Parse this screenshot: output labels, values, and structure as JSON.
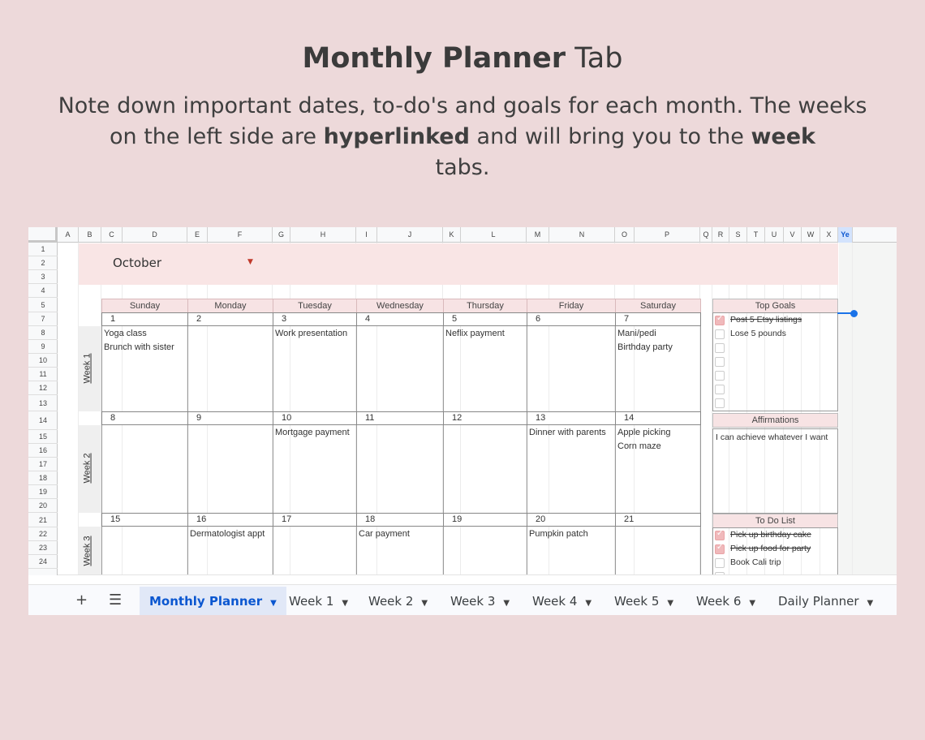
{
  "heading": {
    "title_bold": "Monthly Planner",
    "title_rest": "Tab"
  },
  "description": {
    "part1": "Note down important dates, to-do's and goals for each month. The weeks on the left side are",
    "bold1": "hyperlinked",
    "part2": "and will bring you to the",
    "bold2": "week",
    "part3": "tabs."
  },
  "columns": [
    "A",
    "B",
    "C",
    "D",
    "E",
    "F",
    "G",
    "H",
    "I",
    "J",
    "K",
    "L",
    "M",
    "N",
    "O",
    "P",
    "Q",
    "R",
    "S",
    "T",
    "U",
    "V",
    "W",
    "X",
    "Ye"
  ],
  "rows": [
    "1",
    "2",
    "3",
    "4",
    "5",
    "7",
    "8",
    "9",
    "10",
    "11",
    "12",
    "13",
    "14",
    "15",
    "16",
    "17",
    "18",
    "19",
    "20",
    "21",
    "22",
    "23",
    "24"
  ],
  "calendar": {
    "month": "October",
    "days": [
      "Sunday",
      "Monday",
      "Tuesday",
      "Wednesday",
      "Thursday",
      "Friday",
      "Saturday"
    ],
    "weeks": [
      {
        "label": "Week 1",
        "dates": [
          "1",
          "2",
          "3",
          "4",
          "5",
          "6",
          "7"
        ],
        "events": [
          [
            "Yoga class",
            "Brunch with sister"
          ],
          [],
          [
            "Work presentation"
          ],
          [],
          [
            "Neflix payment"
          ],
          [],
          [
            "Mani/pedi",
            "Birthday party"
          ]
        ]
      },
      {
        "label": "Week 2",
        "dates": [
          "8",
          "9",
          "10",
          "11",
          "12",
          "13",
          "14"
        ],
        "events": [
          [],
          [],
          [
            "Mortgage payment"
          ],
          [],
          [],
          [
            "Dinner with parents"
          ],
          [
            "Apple picking",
            "Corn maze"
          ]
        ]
      },
      {
        "label": "Week 3",
        "dates": [
          "15",
          "16",
          "17",
          "18",
          "19",
          "20",
          "21"
        ],
        "events": [
          [],
          [
            "Dermatologist appt"
          ],
          [],
          [
            "Car payment"
          ],
          [],
          [
            "Pumpkin patch"
          ],
          []
        ]
      }
    ]
  },
  "top_goals": {
    "title": "Top Goals",
    "items": [
      {
        "text": "Post 5 Etsy listings",
        "done": true
      },
      {
        "text": "Lose 5 pounds",
        "done": false
      },
      {
        "text": "",
        "done": false
      },
      {
        "text": "",
        "done": false
      },
      {
        "text": "",
        "done": false
      },
      {
        "text": "",
        "done": false
      },
      {
        "text": "",
        "done": false
      }
    ]
  },
  "affirmations": {
    "title": "Affirmations",
    "text": "I can achieve whatever I want"
  },
  "todo": {
    "title": "To Do List",
    "items": [
      {
        "text": "Pick up birthday cake",
        "done": true
      },
      {
        "text": "Pick up food for party",
        "done": true
      },
      {
        "text": "Book Cali trip",
        "done": false
      }
    ]
  },
  "toolbar": {
    "add_icon": "plus-icon",
    "sheets_icon": "menu-icon"
  },
  "tabs": [
    "Monthly Planner",
    "Week 1",
    "Week 2",
    "Week 3",
    "Week 4",
    "Week 5",
    "Week 6",
    "Daily Planner"
  ],
  "active_tab": "Monthly Planner",
  "colors": {
    "background": "#edd9da",
    "header_pink": "#f7e3e4",
    "check_pink": "#f0b9bb",
    "accent_blue": "#0b57d0"
  }
}
